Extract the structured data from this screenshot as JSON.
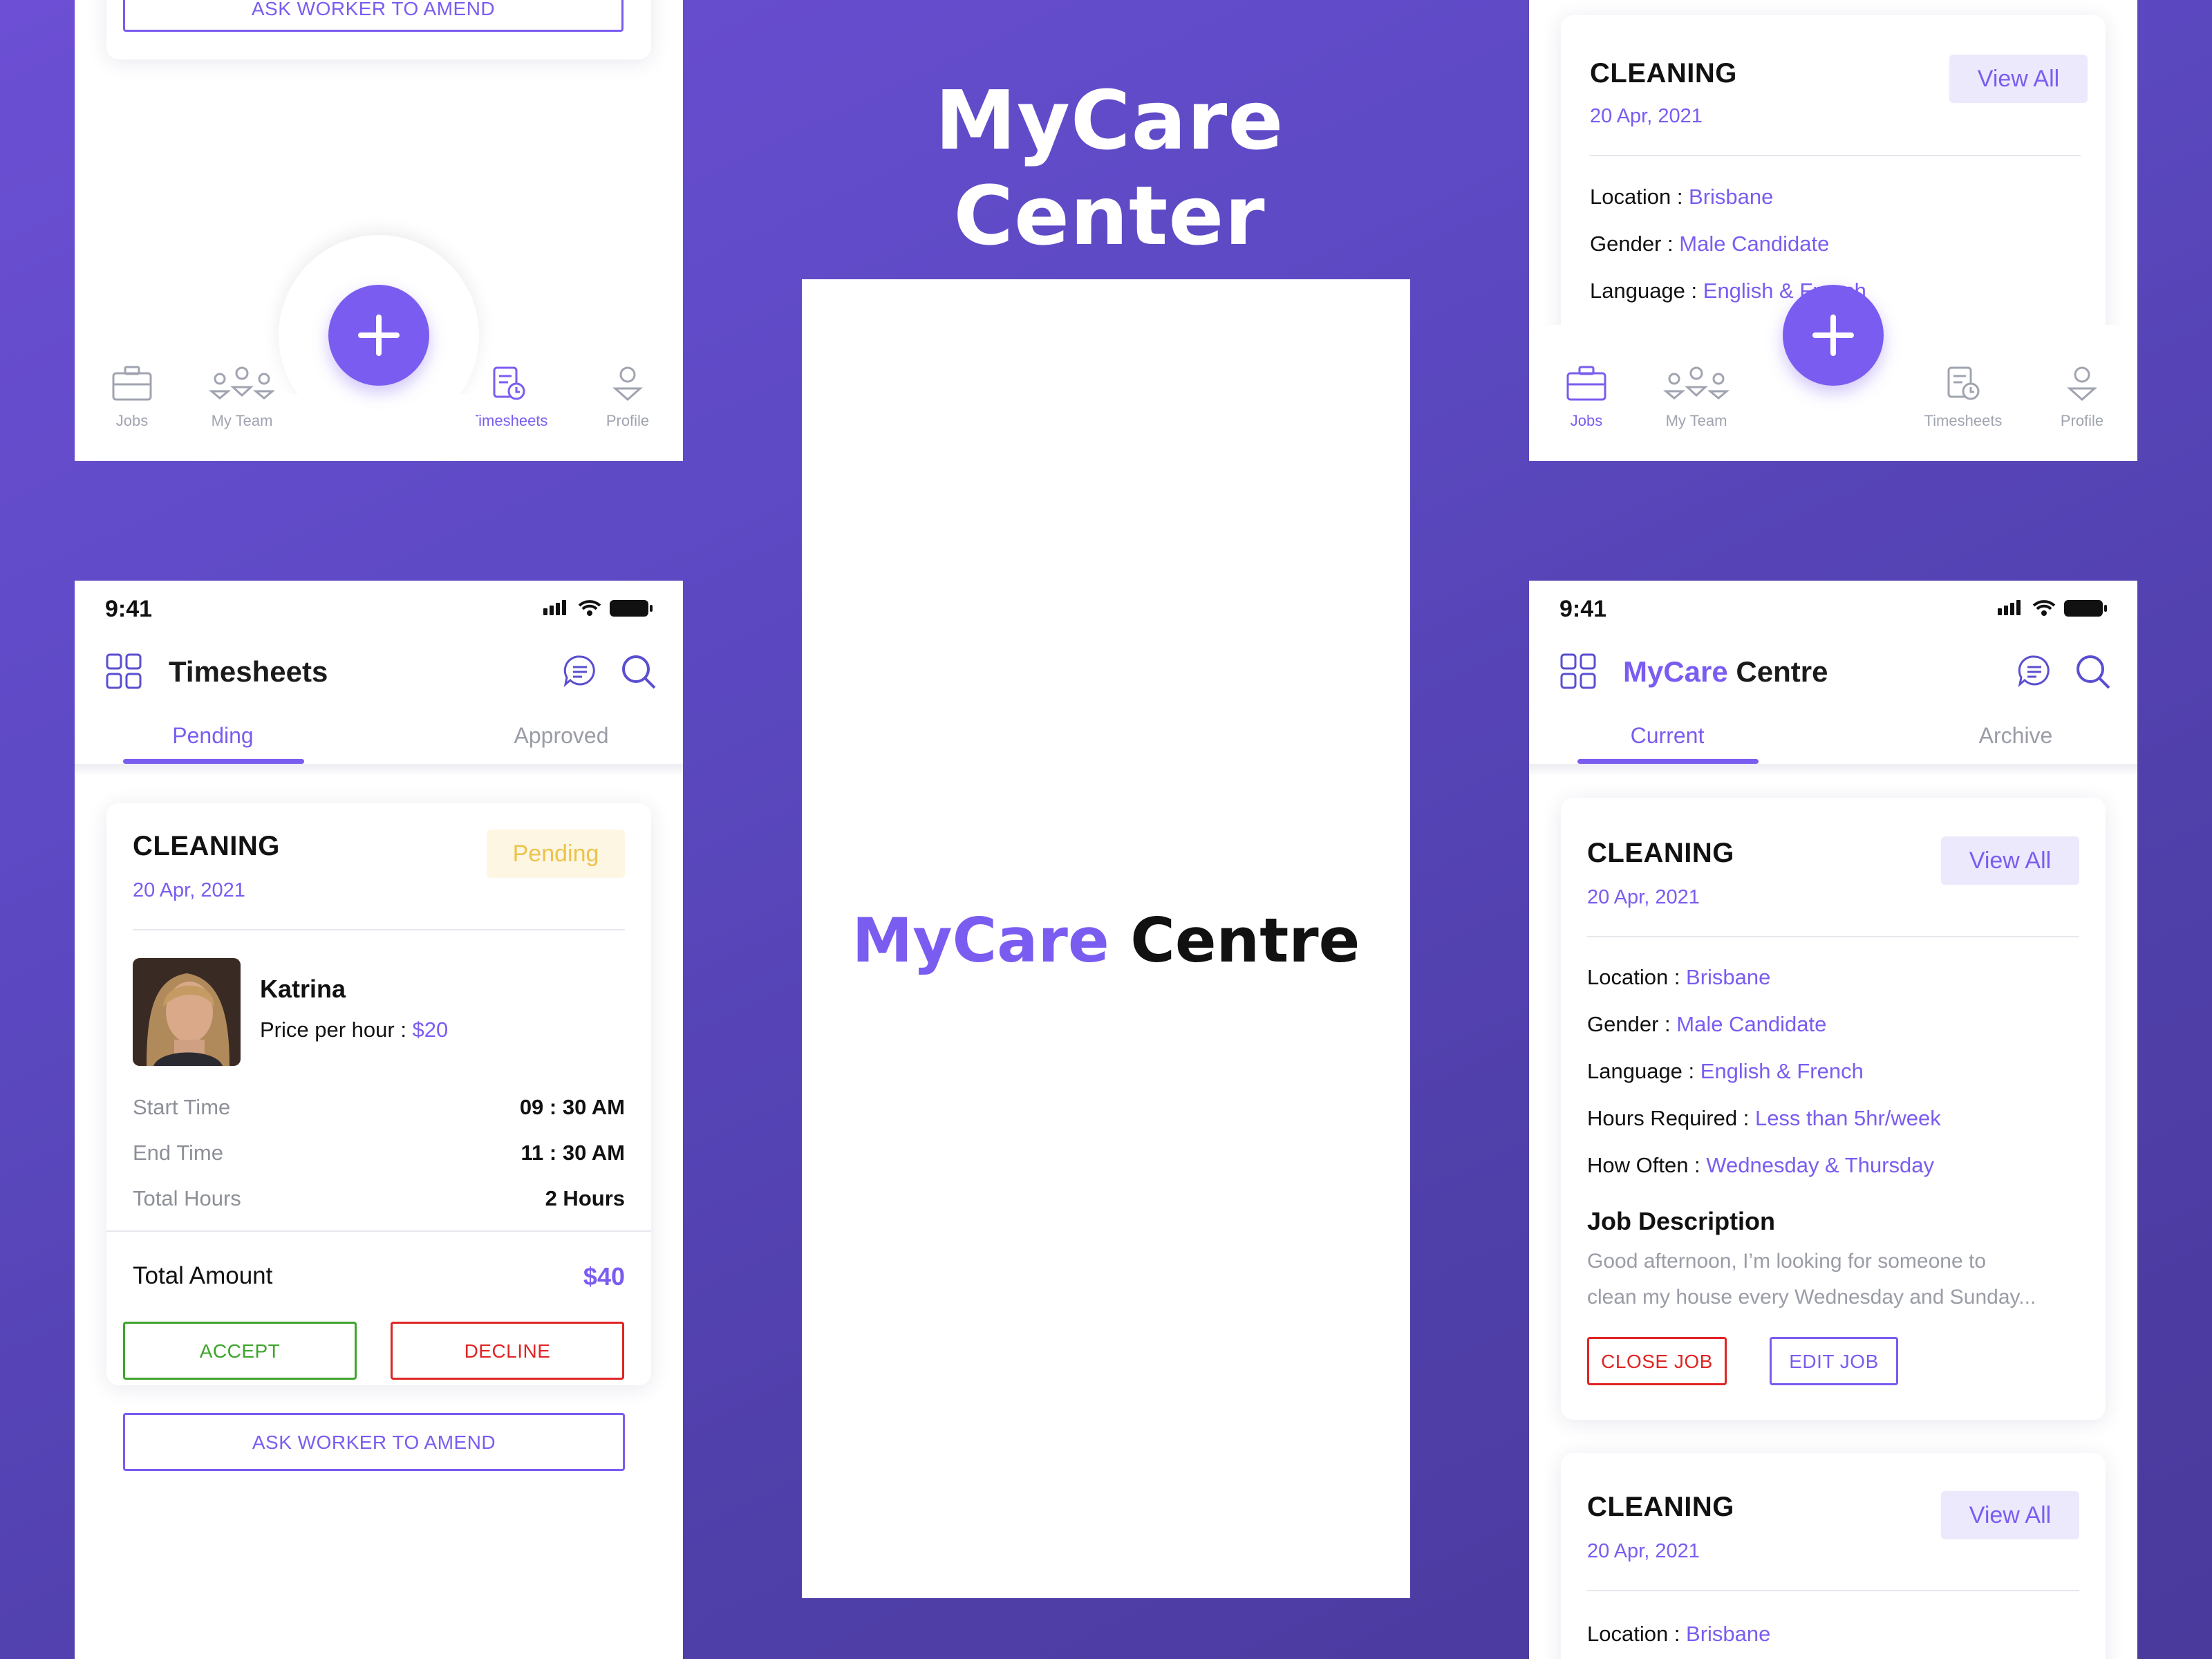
{
  "headline": "MyCare Center",
  "status": {
    "time": "9:41"
  },
  "nav": {
    "jobs": "Jobs",
    "team": "My Team",
    "timesheets": "Timesheets",
    "profile": "Profile"
  },
  "splash": {
    "brand_a": "MyCare",
    "brand_b": "Centre"
  },
  "top_left": {
    "amend_label": "ASK WORKER TO AMEND"
  },
  "top_right": {
    "title": "CLEANING",
    "date": "20 Apr, 2021",
    "view_all": "View All",
    "location_label": "Location : ",
    "location_value": "Brisbane",
    "gender_label": "Gender : ",
    "gender_value": "Male Candidate",
    "language_label": "Language : ",
    "language_value": "English & French"
  },
  "timesheets": {
    "title": "Timesheets",
    "tabs": [
      "Pending",
      "Approved"
    ],
    "card": {
      "title": "CLEANING",
      "date": "20 Apr, 2021",
      "status": "Pending",
      "worker_name": "Katrina",
      "price_label": "Price per hour : ",
      "price_value": "$20",
      "rows": [
        {
          "label": "Start Time",
          "value": "09 : 30 AM"
        },
        {
          "label": "End Time",
          "value": "11 : 30 AM"
        },
        {
          "label": "Total Hours",
          "value": "2 Hours"
        }
      ],
      "total_label": "Total Amount",
      "total_value": "$40",
      "accept": "ACCEPT",
      "decline": "DECLINE",
      "amend": "ASK WORKER TO AMEND"
    }
  },
  "jobs": {
    "title_a": "MyCare",
    "title_b": "Centre",
    "tabs": [
      "Current",
      "Archive"
    ],
    "card1": {
      "title": "CLEANING",
      "date": "20 Apr, 2021",
      "view_all": "View All",
      "location_label": "Location : ",
      "location_value": "Brisbane",
      "gender_label": "Gender : ",
      "gender_value": "Male Candidate",
      "language_label": "Language : ",
      "language_value": "English & French",
      "hours_label": "Hours Required : ",
      "hours_value": "Less than 5hr/week",
      "often_label": "How Often : ",
      "often_value": "Wednesday & Thursday",
      "desc_title": "Job Description",
      "desc_line1": "Good afternoon, I’m looking for someone to",
      "desc_line2": "clean my house every Wednesday and Sunday...",
      "close_job": "CLOSE JOB",
      "edit_job": "EDIT JOB"
    },
    "card2": {
      "title": "CLEANING",
      "date": "20 Apr, 2021",
      "view_all": "View All",
      "location_label": "Location : ",
      "location_value": "Brisbane"
    }
  },
  "colors": {
    "accent": "#7B5CF0",
    "accept": "#3CA52A",
    "decline": "#E02424",
    "pending_bg": "#FDF6E3",
    "pending_fg": "#EDC34B"
  }
}
